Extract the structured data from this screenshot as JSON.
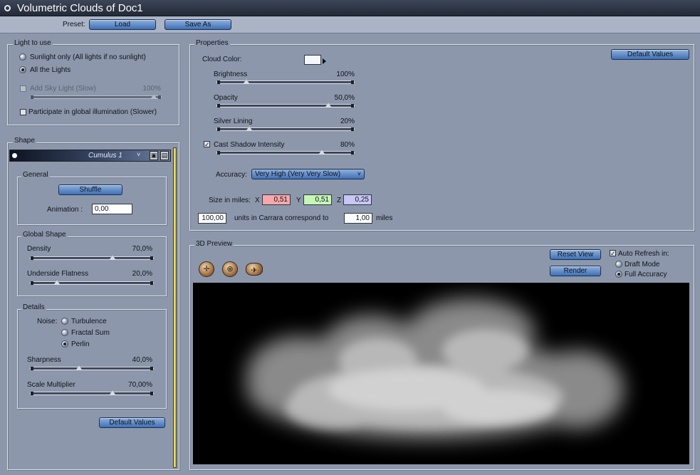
{
  "window": {
    "title": "Volumetric Clouds of Doc1"
  },
  "preset": {
    "label": "Preset:",
    "load": "Load",
    "save_as": "Save As"
  },
  "light": {
    "group": "Light to use",
    "sunlight": "Sunlight only (All lights if no sunlight)",
    "all_lights": "All the Lights",
    "selected": "all_lights",
    "sky_light": "Add Sky Light (Slow)",
    "sky_light_value": "100%",
    "sky_light_level": 1.0,
    "sky_light_checked": false,
    "global_illum": "Participate in global illumination (Slower)",
    "global_illum_checked": false
  },
  "shape": {
    "group": "Shape",
    "preset_name": "Cumulus 1",
    "general": {
      "group": "General",
      "shuffle": "Shuffle",
      "animation_label": "Animation :",
      "animation_value": "0,00"
    },
    "global_shape": {
      "group": "Global Shape",
      "density_label": "Density",
      "density_value": "70,0%",
      "density_level": 0.7,
      "flatness_label": "Underside Flatness",
      "flatness_value": "20,0%",
      "flatness_level": 0.2
    },
    "details": {
      "group": "Details",
      "noise_label": "Noise:",
      "turbulence": "Turbulence",
      "fractal": "Fractal Sum",
      "perlin": "Perlin",
      "selected": "perlin",
      "sharpness_label": "Sharpness",
      "sharpness_value": "40,0%",
      "sharpness_level": 0.4,
      "scale_label": "Scale Multiplier",
      "scale_value": "70,00%",
      "scale_level": 0.7
    },
    "default_values": "Default Values"
  },
  "properties": {
    "group": "Properties",
    "cloud_color_label": "Cloud Color:",
    "cloud_color": "#f4f6fb",
    "default_values": "Default Values",
    "brightness_label": "Brightness",
    "brightness_value": "100%",
    "brightness_level": 0.2,
    "opacity_label": "Opacity",
    "opacity_value": "50,0%",
    "opacity_level": 0.85,
    "silver_label": "Silver Lining",
    "silver_value": "20%",
    "silver_level": 0.22,
    "shadow_label": "Cast Shadow Intensity",
    "shadow_value": "80%",
    "shadow_level": 0.8,
    "shadow_checked": true,
    "accuracy_label": "Accuracy:",
    "accuracy_value": "Very High (Very Very Slow)",
    "size_label": "Size in miles:",
    "x_label": "X",
    "x_value": "0,51",
    "x_color": "#f7a8aa",
    "y_label": "Y",
    "y_value": "0,51",
    "y_color": "#c6f5b5",
    "z_label": "Z",
    "z_value": "0,25",
    "z_color": "#c7c6f6",
    "units_value": "100,00",
    "units_text": "units in Carrara correspond to",
    "miles_value": "1,00",
    "miles_text": "miles"
  },
  "preview": {
    "group": "3D Preview",
    "reset_view": "Reset View",
    "render": "Render",
    "auto_refresh": "Auto Refresh in:",
    "auto_refresh_checked": true,
    "draft": "Draft Mode",
    "full": "Full Accuracy",
    "selected": "full",
    "tools": [
      "move-icon",
      "rotate-icon",
      "fly-icon"
    ]
  }
}
